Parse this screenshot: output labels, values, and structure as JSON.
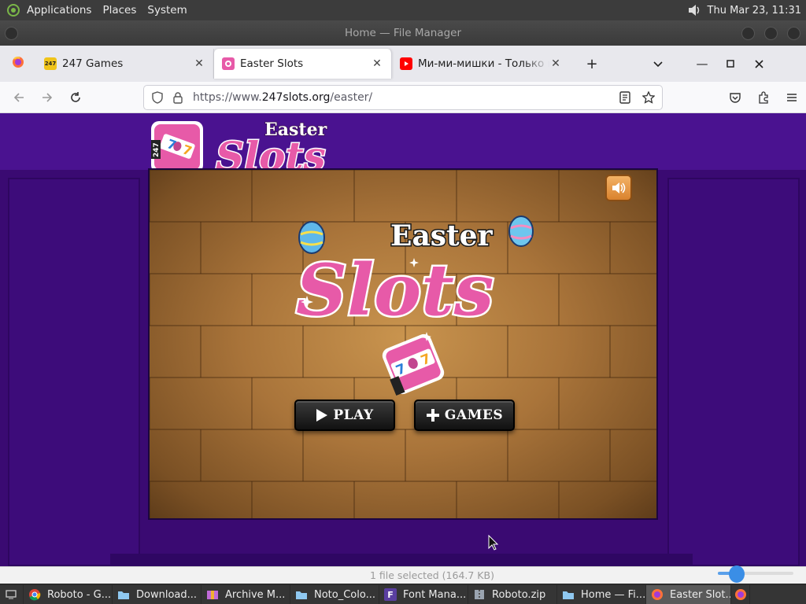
{
  "top_panel": {
    "menus": [
      "Applications",
      "Places",
      "System"
    ],
    "clock": "Thu Mar 23, 11:31"
  },
  "window": {
    "title": "Home — File Manager"
  },
  "browser": {
    "tabs": [
      {
        "label": "247 Games"
      },
      {
        "label": "Easter Slots"
      },
      {
        "label": "Ми-ми-мишки - Только нс"
      }
    ],
    "url_prefix": "https://www.",
    "url_host": "247slots.org",
    "url_path": "/easter/"
  },
  "page": {
    "site_title_top": "Easter",
    "site_title_main": "Slots",
    "logo_text": "247",
    "game": {
      "title_top": "Easter",
      "title_main": "Slots",
      "play_label": "PLAY",
      "games_label": "GAMES"
    }
  },
  "status_bar": {
    "text": "1 file selected (164.7 KB)"
  },
  "taskbar": {
    "items": [
      {
        "label": "Roboto - G...",
        "icon": "chrome-icon"
      },
      {
        "label": "Download...",
        "icon": "folder-icon"
      },
      {
        "label": "Archive M...",
        "icon": "archive-icon"
      },
      {
        "label": "Noto_Colo...",
        "icon": "folder-icon"
      },
      {
        "label": "Font Mana...",
        "icon": "font-icon"
      },
      {
        "label": "Roboto.zip",
        "icon": "zip-icon"
      },
      {
        "label": "Home — Fi...",
        "icon": "folder-icon"
      },
      {
        "label": "Easter Slot...",
        "icon": "firefox-icon"
      }
    ]
  },
  "colors": {
    "page_bg": "#3a0a72",
    "pink": "#e75aa8",
    "firefox_orange": "#ff7139"
  }
}
